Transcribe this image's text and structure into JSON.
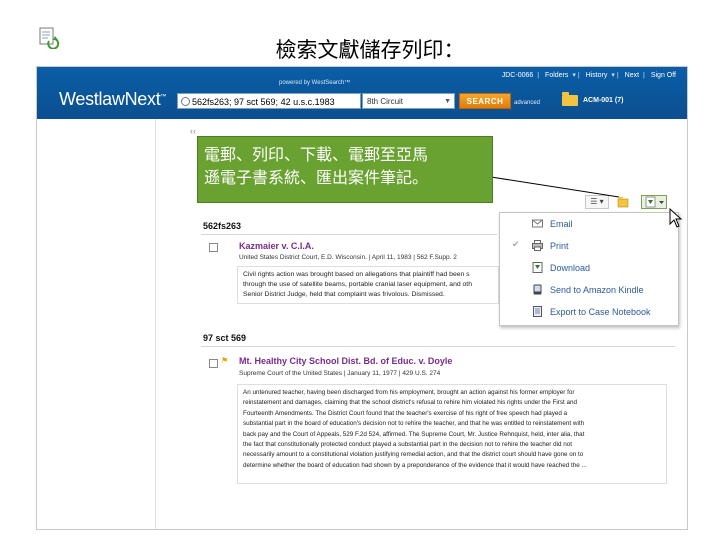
{
  "slide": {
    "title": "檢索文獻儲存列印："
  },
  "westlaw": {
    "logo": "WestlawNext",
    "logo_tm": "™",
    "powered_by": "powered by WestSearch™",
    "top_links": [
      "JDC-0066",
      "Folders",
      "History",
      "Next",
      "Sign Off"
    ],
    "search_value": "562fs263; 97 sct 569; 42 u.s.c.1983",
    "jurisdiction": "8th Circuit",
    "search_button": "SEARCH",
    "advanced": "advanced",
    "folder": "ACM-001 (7)"
  },
  "callout": {
    "text_line1": "電郵、列印、下載、電郵至亞馬",
    "text_line2": "遜電子書系統、匯出案件筆記。"
  },
  "results": {
    "collapse_glyph": "‹‹",
    "groups": [
      {
        "heading": "562fs263",
        "case": {
          "title": "Kazmaier v. C.I.A.",
          "meta": "United States District Court, E.D. Wisconsin.  |  April 11, 1983  |  562 F.Supp. 2",
          "abstract": [
            "Civil rights action was brought based on allegations that plaintiff had been s",
            "through the use of satellite beams, portable cranial laser equipment, and oth",
            "Senior District Judge, held that complaint was frivolous. Dismissed."
          ]
        }
      },
      {
        "heading": "97 sct 569",
        "case": {
          "title": "Mt. Healthy City School Dist. Bd. of Educ. v. Doyle",
          "meta": "Supreme Court of the United States  |  January 11, 1977  |  429 U.S. 274",
          "abstract": [
            "An untenured teacher, having been discharged from his employment, brought an action against his former employer for",
            "reinstatement and damages, claiming that the school district's refusal to rehire him violated his rights under the First and",
            "Fourteenth Amendments. The District Court found that the teacher's exercise of his right of free speech had played a",
            "substantial part in the board of education's decision not to rehire the teacher, and that he was entitled to reinstatement with",
            "back pay and the Court of Appeals, 529 F.2d 524, affirmed. The Supreme Court, Mr. Justice Rehnquist, held, inter alia, that",
            "the fact that constitutionally protected conduct played a substantial part in the decision not to rehire the teacher did not",
            "necessarily amount to a constitutional violation justifying remedial action, and that the district court should have gone on to",
            "determine whether the board of education had shown by a preponderance of the evidence that it would have reached the ..."
          ]
        }
      }
    ]
  },
  "delivery_menu": {
    "items": [
      {
        "label": "Email",
        "icon": "envelope-icon"
      },
      {
        "label": "Print",
        "icon": "printer-icon",
        "checked": true
      },
      {
        "label": "Download",
        "icon": "download-icon"
      },
      {
        "label": "Send to Amazon Kindle",
        "icon": "kindle-icon"
      },
      {
        "label": "Export to Case Notebook",
        "icon": "notebook-icon"
      }
    ]
  },
  "colors": {
    "header_blue": "#0b5699",
    "search_orange": "#f08a10",
    "callout_green": "#6aa232",
    "case_title_purple": "#7a2b8f",
    "menu_link_blue": "#2a5a9e"
  }
}
